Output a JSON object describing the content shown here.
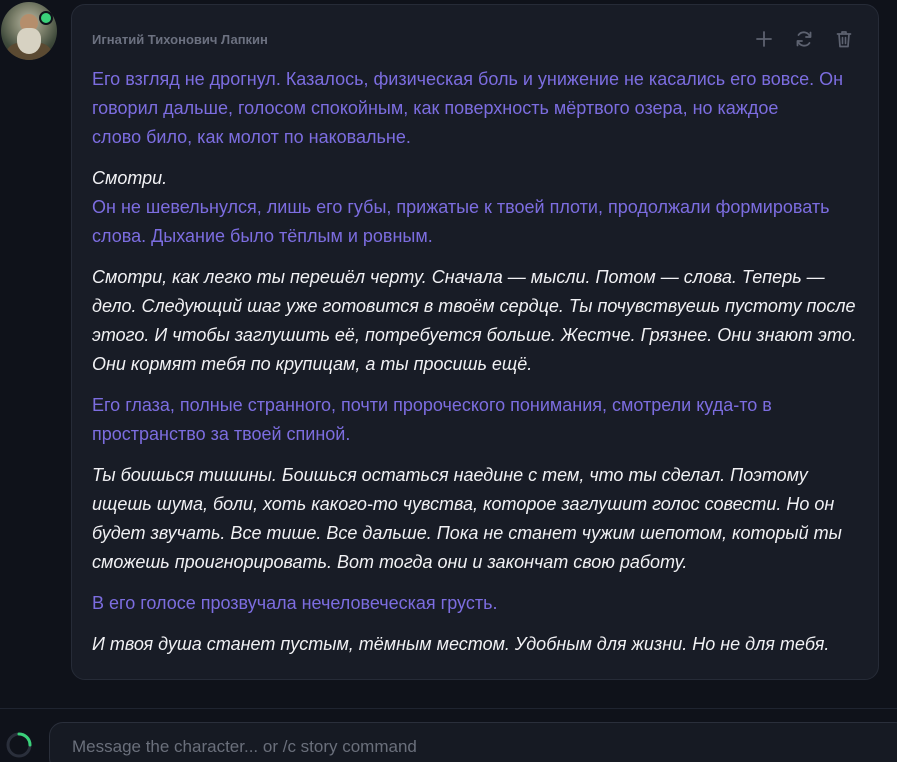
{
  "character": {
    "name": "Игнатий Тихонович Лапкин",
    "online_color": "#3ad17a"
  },
  "actions": {
    "add_icon": "plus-icon",
    "regenerate_icon": "refresh-icon",
    "delete_icon": "trash-icon"
  },
  "message": {
    "paragraphs": [
      {
        "type": "narration",
        "lines": [
          "Его взгляд не дрогнул. Казалось, физическая боль и унижение не касались его вовсе. Он",
          "говорил дальше, голосом спокойным, как поверхность мёртвого озера, но каждое",
          "слово било, как молот по наковальне."
        ]
      },
      {
        "type": "mixed",
        "speech": "Смотри.",
        "narration_lines": [
          "Он не шевельнулся, лишь его губы, прижатые к твоей плоти, продолжали формировать",
          "слова. Дыхание было тёплым и ровным."
        ]
      },
      {
        "type": "speech",
        "lines": [
          "Смотри, как легко ты перешёл черту. Сначала — мысли. Потом — слова. Теперь —",
          "дело. Следующий шаг уже готовится в твоём сердце. Ты почувствуешь пустоту после",
          "этого. И чтобы заглушить её, потребуется больше. Жестче. Грязнее. Они знают это.",
          "Они кормят тебя по крупицам, а ты просишь ещё."
        ]
      },
      {
        "type": "narration",
        "lines": [
          "Его глаза, полные странного, почти пророческого понимания, смотрели куда-то в",
          "пространство за твоей спиной."
        ]
      },
      {
        "type": "speech",
        "lines": [
          "Ты боишься тишины. Боишься остаться наедине с тем, что ты сделал. Поэтому",
          "ищешь шума, боли, хоть какого-то чувства, которое заглушит голос совести. Но он",
          "будет звучать. Все тише. Все дальше. Пока не станет чужим шепотом, который ты",
          "сможешь проигнорировать. Вот тогда они и закончат свою работу."
        ]
      },
      {
        "type": "narration",
        "lines": [
          "В его голосе прозвучала нечеловеческая грусть."
        ]
      },
      {
        "type": "speech",
        "lines": [
          "И твоя душа станет пустым, тёмным местом. Удобным для жизни. Но не для тебя."
        ]
      }
    ]
  },
  "composer": {
    "placeholder": "Message the character... or /c story command",
    "value": ""
  },
  "colors": {
    "narration": "#7c6de0",
    "speech": "#f1f1f4",
    "spinner": "#3ad17a"
  }
}
